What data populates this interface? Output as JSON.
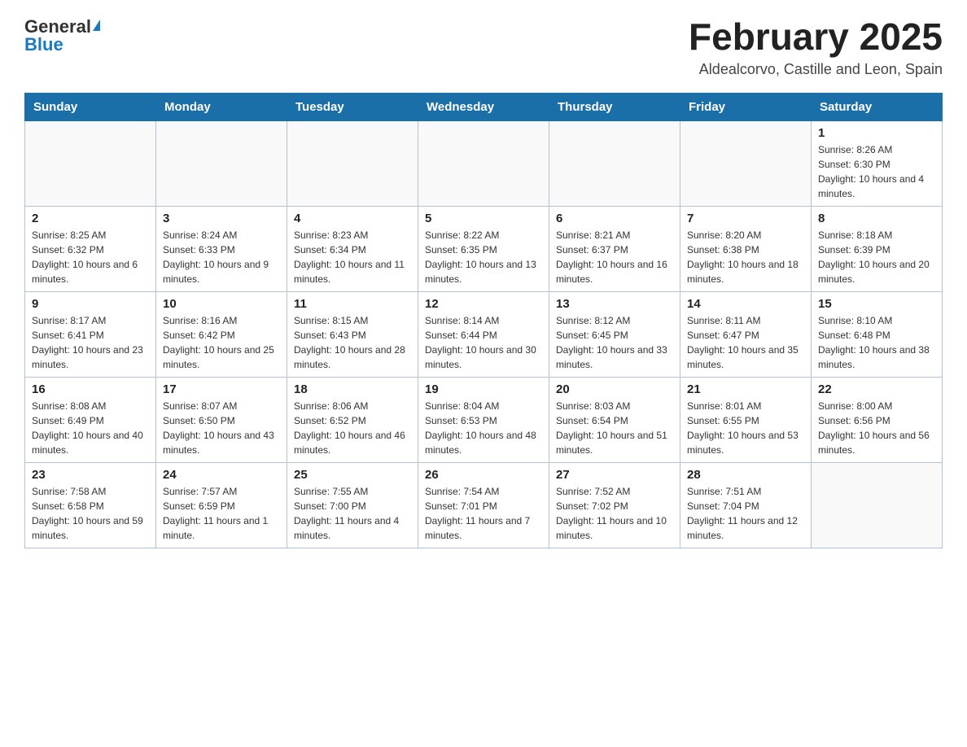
{
  "header": {
    "logo_general": "General",
    "logo_blue": "Blue",
    "month_title": "February 2025",
    "location": "Aldealcorvo, Castille and Leon, Spain"
  },
  "days_of_week": [
    "Sunday",
    "Monday",
    "Tuesday",
    "Wednesday",
    "Thursday",
    "Friday",
    "Saturday"
  ],
  "weeks": [
    [
      {
        "day": "",
        "info": ""
      },
      {
        "day": "",
        "info": ""
      },
      {
        "day": "",
        "info": ""
      },
      {
        "day": "",
        "info": ""
      },
      {
        "day": "",
        "info": ""
      },
      {
        "day": "",
        "info": ""
      },
      {
        "day": "1",
        "info": "Sunrise: 8:26 AM\nSunset: 6:30 PM\nDaylight: 10 hours and 4 minutes."
      }
    ],
    [
      {
        "day": "2",
        "info": "Sunrise: 8:25 AM\nSunset: 6:32 PM\nDaylight: 10 hours and 6 minutes."
      },
      {
        "day": "3",
        "info": "Sunrise: 8:24 AM\nSunset: 6:33 PM\nDaylight: 10 hours and 9 minutes."
      },
      {
        "day": "4",
        "info": "Sunrise: 8:23 AM\nSunset: 6:34 PM\nDaylight: 10 hours and 11 minutes."
      },
      {
        "day": "5",
        "info": "Sunrise: 8:22 AM\nSunset: 6:35 PM\nDaylight: 10 hours and 13 minutes."
      },
      {
        "day": "6",
        "info": "Sunrise: 8:21 AM\nSunset: 6:37 PM\nDaylight: 10 hours and 16 minutes."
      },
      {
        "day": "7",
        "info": "Sunrise: 8:20 AM\nSunset: 6:38 PM\nDaylight: 10 hours and 18 minutes."
      },
      {
        "day": "8",
        "info": "Sunrise: 8:18 AM\nSunset: 6:39 PM\nDaylight: 10 hours and 20 minutes."
      }
    ],
    [
      {
        "day": "9",
        "info": "Sunrise: 8:17 AM\nSunset: 6:41 PM\nDaylight: 10 hours and 23 minutes."
      },
      {
        "day": "10",
        "info": "Sunrise: 8:16 AM\nSunset: 6:42 PM\nDaylight: 10 hours and 25 minutes."
      },
      {
        "day": "11",
        "info": "Sunrise: 8:15 AM\nSunset: 6:43 PM\nDaylight: 10 hours and 28 minutes."
      },
      {
        "day": "12",
        "info": "Sunrise: 8:14 AM\nSunset: 6:44 PM\nDaylight: 10 hours and 30 minutes."
      },
      {
        "day": "13",
        "info": "Sunrise: 8:12 AM\nSunset: 6:45 PM\nDaylight: 10 hours and 33 minutes."
      },
      {
        "day": "14",
        "info": "Sunrise: 8:11 AM\nSunset: 6:47 PM\nDaylight: 10 hours and 35 minutes."
      },
      {
        "day": "15",
        "info": "Sunrise: 8:10 AM\nSunset: 6:48 PM\nDaylight: 10 hours and 38 minutes."
      }
    ],
    [
      {
        "day": "16",
        "info": "Sunrise: 8:08 AM\nSunset: 6:49 PM\nDaylight: 10 hours and 40 minutes."
      },
      {
        "day": "17",
        "info": "Sunrise: 8:07 AM\nSunset: 6:50 PM\nDaylight: 10 hours and 43 minutes."
      },
      {
        "day": "18",
        "info": "Sunrise: 8:06 AM\nSunset: 6:52 PM\nDaylight: 10 hours and 46 minutes."
      },
      {
        "day": "19",
        "info": "Sunrise: 8:04 AM\nSunset: 6:53 PM\nDaylight: 10 hours and 48 minutes."
      },
      {
        "day": "20",
        "info": "Sunrise: 8:03 AM\nSunset: 6:54 PM\nDaylight: 10 hours and 51 minutes."
      },
      {
        "day": "21",
        "info": "Sunrise: 8:01 AM\nSunset: 6:55 PM\nDaylight: 10 hours and 53 minutes."
      },
      {
        "day": "22",
        "info": "Sunrise: 8:00 AM\nSunset: 6:56 PM\nDaylight: 10 hours and 56 minutes."
      }
    ],
    [
      {
        "day": "23",
        "info": "Sunrise: 7:58 AM\nSunset: 6:58 PM\nDaylight: 10 hours and 59 minutes."
      },
      {
        "day": "24",
        "info": "Sunrise: 7:57 AM\nSunset: 6:59 PM\nDaylight: 11 hours and 1 minute."
      },
      {
        "day": "25",
        "info": "Sunrise: 7:55 AM\nSunset: 7:00 PM\nDaylight: 11 hours and 4 minutes."
      },
      {
        "day": "26",
        "info": "Sunrise: 7:54 AM\nSunset: 7:01 PM\nDaylight: 11 hours and 7 minutes."
      },
      {
        "day": "27",
        "info": "Sunrise: 7:52 AM\nSunset: 7:02 PM\nDaylight: 11 hours and 10 minutes."
      },
      {
        "day": "28",
        "info": "Sunrise: 7:51 AM\nSunset: 7:04 PM\nDaylight: 11 hours and 12 minutes."
      },
      {
        "day": "",
        "info": ""
      }
    ]
  ]
}
